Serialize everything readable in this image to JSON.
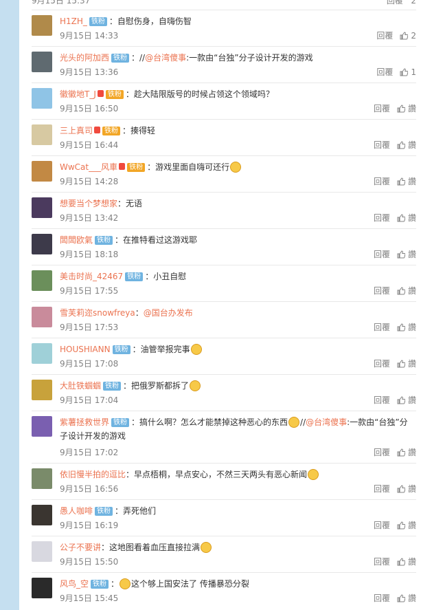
{
  "previous_row": {
    "date": "9月15日 15:37",
    "reply": "回覆",
    "like": "2"
  },
  "comments": [
    {
      "user": "H1ZH_",
      "badge": "铁粉",
      "text": "：自慰伤身，自嗨伤智",
      "time": "9月15日 14:33",
      "reply": "回覆",
      "like": "2",
      "avatar_color": "#b08a4a"
    },
    {
      "user": "光头的阿加西",
      "badge": "铁粉",
      "pre": "：//",
      "mention": "@台湾傻事",
      "text": ":一款由“台独”分子设计开发的游戏",
      "time": "9月15日 13:36",
      "reply": "回覆",
      "like": "1",
      "avatar_color": "#5f6a70"
    },
    {
      "user": "徽徽地T_J",
      "badge": "铁粉",
      "badge_style": "gold",
      "text": "：趁大陆限版号的时候占领这个领域吗？",
      "time": "9月15日 16:50",
      "reply": "回覆",
      "like": "讚",
      "avatar_color": "#8fc4e6"
    },
    {
      "user": "三上真司",
      "badge": "铁粉",
      "badge_style": "gold",
      "text": "：揍得轻",
      "time": "9月15日 16:44",
      "reply": "回覆",
      "like": "讚",
      "avatar_color": "#d7c9a2"
    },
    {
      "user": "WwCat___风車",
      "badge": "铁粉",
      "badge_style": "gold",
      "text": "：游戏里面自嗨可还行",
      "emoji_after": true,
      "time": "9月15日 14:28",
      "reply": "回覆",
      "like": "讚",
      "avatar_color": "#c28944"
    },
    {
      "user": "想要当个梦想家",
      "text": "：无语",
      "time": "9月15日 13:42",
      "reply": "回覆",
      "like": "讚",
      "avatar_color": "#4b3a5e"
    },
    {
      "user": "闆闆欧氣",
      "badge": "铁粉",
      "text": "：在推特看过这游戏耶",
      "time": "9月15日 18:18",
      "reply": "回覆",
      "like": "讚",
      "avatar_color": "#3d3a4a"
    },
    {
      "user": "美击时尚_42467",
      "badge": "铁粉",
      "text": "：小丑自慰",
      "time": "9月15日 17:55",
      "reply": "回覆",
      "like": "讚",
      "avatar_color": "#6b8f5b"
    },
    {
      "user": "雪芙莉迩snowfreya",
      "pre": "：",
      "mention": "@国台办发布",
      "text": "",
      "time": "9月15日 17:53",
      "reply": "回覆",
      "like": "讚",
      "avatar_color": "#c98b9b"
    },
    {
      "user": "HOUSHIANN",
      "badge": "铁粉",
      "text": "：油管举报完事",
      "emoji_after": true,
      "time": "9月15日 17:08",
      "reply": "回覆",
      "like": "讚",
      "avatar_color": "#9fd0d8"
    },
    {
      "user": "大肚铁蝈蝈",
      "badge": "铁粉",
      "text": "：把俄罗斯都拆了",
      "emoji_after": true,
      "time": "9月15日 17:04",
      "reply": "回覆",
      "like": "讚",
      "avatar_color": "#c8a23b"
    },
    {
      "user": "紫薯拯救世界",
      "badge": "铁粉",
      "text": "：搞什么啊？怎么才能禁掉这种恶心的东西",
      "emoji_after": true,
      "post": "//",
      "mention": "@台湾傻事",
      "text2": ":一款由“台独”分子设计开发的游戏",
      "time": "9月15日 17:02",
      "reply": "回覆",
      "like": "讚",
      "avatar_color": "#7a5fb0",
      "tall": true
    },
    {
      "user": "依旧慢半拍的逗比",
      "text": "：早点梧桐，早点安心，不然三天两头有恶心新闻",
      "emoji_after": true,
      "time": "9月15日 16:56",
      "reply": "回覆",
      "like": "讚",
      "avatar_color": "#7a8b6a"
    },
    {
      "user": "愚人咖啡",
      "badge": "铁粉",
      "text": "：弄死他们",
      "time": "9月15日 16:19",
      "reply": "回覆",
      "like": "讚",
      "avatar_color": "#3a3530"
    },
    {
      "user": "公子不要讲",
      "text": "：这地图看着血压直接拉满",
      "emoji_after": true,
      "time": "9月15日 15:50",
      "reply": "回覆",
      "like": "讚",
      "avatar_color": "#d8d8e0"
    },
    {
      "user": "风鸟_空",
      "badge": "铁粉",
      "pre": "：",
      "emoji_before": true,
      "text": "这个够上国安法了 传播暴恐分裂",
      "time": "9月15日 15:45",
      "reply": "回覆",
      "like": "讚",
      "avatar_color": "#2a2a2a"
    }
  ],
  "colors": {
    "username": "#eb7350",
    "meta": "#808080",
    "badge": "#6fb3e0",
    "badge_gold": "#f2a626",
    "page_bg": "#c5dff0"
  },
  "icons": {
    "like": "thumbs-up-icon",
    "emoji": "smiley-emoji-icon"
  }
}
